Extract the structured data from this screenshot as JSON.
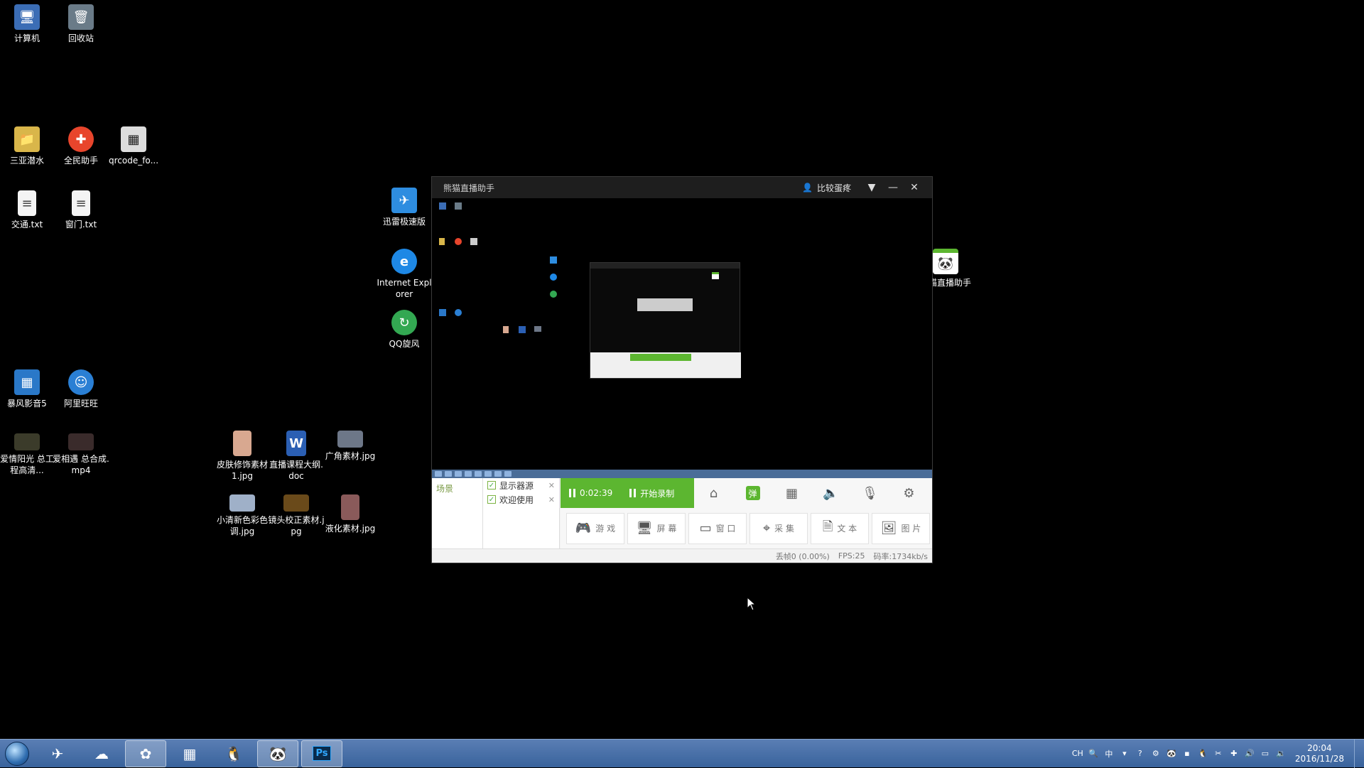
{
  "desktop_icons": [
    {
      "label": "计算机",
      "icon": "computer-icon"
    },
    {
      "label": "回收站",
      "icon": "recycle-bin-icon"
    },
    {
      "label": "三亚潜水",
      "icon": "folder-icon"
    },
    {
      "label": "全民助手",
      "icon": "app-icon"
    },
    {
      "label": "qrcode_fo...",
      "icon": "qrcode-icon"
    },
    {
      "label": "交通.txt",
      "icon": "text-file-icon"
    },
    {
      "label": "窗门.txt",
      "icon": "text-file-icon"
    },
    {
      "label": "迅雷极速版",
      "icon": "thunder-icon"
    },
    {
      "label": "Internet Explorer",
      "icon": "ie-icon"
    },
    {
      "label": "QQ旋风",
      "icon": "qq-whirlwind-icon"
    },
    {
      "label": "熊猫直播助手",
      "icon": "panda-live-icon"
    },
    {
      "label": "暴风影音5",
      "icon": "video-player-icon"
    },
    {
      "label": "阿里旺旺",
      "icon": "aliwangwang-icon"
    },
    {
      "label": "爱情阳光 总工程高清...",
      "icon": "video-file-icon"
    },
    {
      "label": "爱相遇 总合成.mp4",
      "icon": "video-file-icon"
    },
    {
      "label": "皮肤修饰素材1.jpg",
      "icon": "image-file-icon"
    },
    {
      "label": "直播课程大纲.doc",
      "icon": "word-file-icon"
    },
    {
      "label": "广角素材.jpg",
      "icon": "image-file-icon"
    },
    {
      "label": "小清新色彩色调.jpg",
      "icon": "image-file-icon"
    },
    {
      "label": "镜头校正素材.jpg",
      "icon": "image-file-icon"
    },
    {
      "label": "液化素材.jpg",
      "icon": "image-file-icon"
    }
  ],
  "app": {
    "title": "熊猫直播助手",
    "user": "比较蛋疼",
    "scene_header": "场景",
    "sources": [
      {
        "label": "显示器源",
        "checked": true
      },
      {
        "label": "欢迎使用",
        "checked": true
      }
    ],
    "timer": "0:02:39",
    "record_label": "开始录制",
    "add_buttons": [
      {
        "label": "游 戏",
        "icon": "gamepad-icon"
      },
      {
        "label": "屏 幕",
        "icon": "monitor-icon"
      },
      {
        "label": "窗 口",
        "icon": "window-icon"
      },
      {
        "label": "采 集",
        "icon": "location-icon"
      },
      {
        "label": "文 本",
        "icon": "document-icon"
      },
      {
        "label": "图 片",
        "icon": "image-icon"
      }
    ],
    "status": {
      "dropped": "丢帧0 (0.00%)",
      "fps": "FPS:25",
      "bitrate": "码率:1734kb/s"
    }
  },
  "taskbar": {
    "apps": [
      "thunder",
      "baidu-cloud",
      "picasa",
      "video-player",
      "qq",
      "panda-live",
      "photoshop"
    ],
    "tray_lang": "CH",
    "tray_ime": "中",
    "time": "20:04",
    "date": "2016/11/28"
  },
  "colors": {
    "accent_green": "#5cb630",
    "taskbar": "#39639c",
    "title_bar": "#1e1e1e"
  }
}
